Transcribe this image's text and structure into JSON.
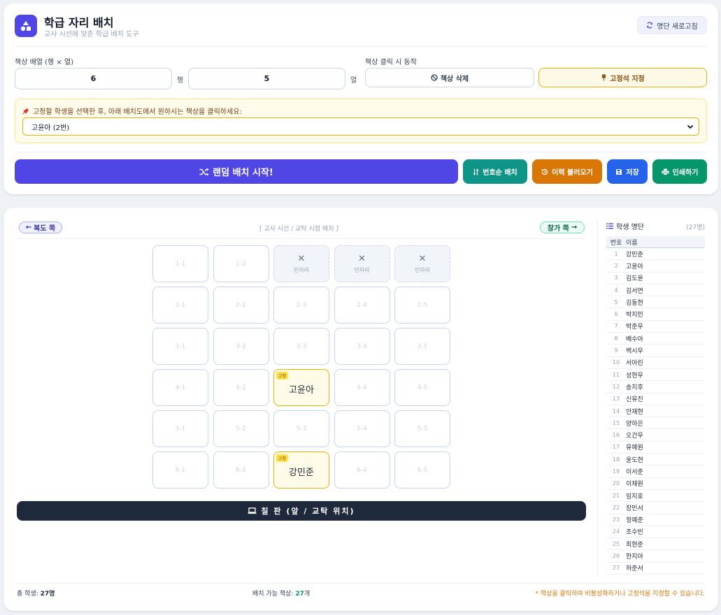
{
  "header": {
    "title": "학급 자리 배치",
    "subtitle": "교사 시선에 맞춘 학급 배치 도구",
    "refresh_label": "명단 새로고침"
  },
  "controls": {
    "layout_label": "책상 배열 (행 × 열)",
    "rows_value": "6",
    "rows_unit": "행",
    "cols_value": "5",
    "cols_unit": "열",
    "click_action_label": "책상 클릭 시 동작",
    "delete_mode_label": "책상 삭제",
    "fixed_mode_label": "고정석 지정"
  },
  "notice": {
    "text": "고정할 학생을 선택한 후, 아래 배치도에서 원하시는 책상을 클릭하세요:",
    "selected_student": "고윤아 (2번)"
  },
  "actions": {
    "random_label": "랜덤 배치 시작!",
    "number_order_label": "번호순 배치",
    "history_label": "이력 불러오기",
    "save_label": "저장",
    "print_label": "인쇄하기"
  },
  "seat_map": {
    "north_label": "복도 쪽",
    "view_label": "[ 교사 시선 / 교탁 시점 배치 ]",
    "window_label": "창가 쪽",
    "empty_label": "빈자리",
    "fixed_badge": "고정",
    "board_label": "칠 판 (앞 / 교탁 위치)",
    "rows": [
      [
        {
          "type": "desk",
          "label": "1-1"
        },
        {
          "type": "desk",
          "label": "1-2"
        },
        {
          "type": "empty"
        },
        {
          "type": "empty"
        },
        {
          "type": "empty"
        }
      ],
      [
        {
          "type": "desk",
          "label": "2-1"
        },
        {
          "type": "desk",
          "label": "2-2"
        },
        {
          "type": "desk",
          "label": "2-3"
        },
        {
          "type": "desk",
          "label": "2-4"
        },
        {
          "type": "desk",
          "label": "2-5"
        }
      ],
      [
        {
          "type": "desk",
          "label": "3-1"
        },
        {
          "type": "desk",
          "label": "3-2"
        },
        {
          "type": "desk",
          "label": "3-3"
        },
        {
          "type": "desk",
          "label": "3-4"
        },
        {
          "type": "desk",
          "label": "3-5"
        }
      ],
      [
        {
          "type": "desk",
          "label": "4-1"
        },
        {
          "type": "desk",
          "label": "4-2"
        },
        {
          "type": "fixed",
          "name": "고윤아"
        },
        {
          "type": "desk",
          "label": "4-4"
        },
        {
          "type": "desk",
          "label": "4-5"
        }
      ],
      [
        {
          "type": "desk",
          "label": "5-1"
        },
        {
          "type": "desk",
          "label": "5-2"
        },
        {
          "type": "desk",
          "label": "5-3"
        },
        {
          "type": "desk",
          "label": "5-4"
        },
        {
          "type": "desk",
          "label": "5-5"
        }
      ],
      [
        {
          "type": "desk",
          "label": "6-1"
        },
        {
          "type": "desk",
          "label": "6-2"
        },
        {
          "type": "fixed",
          "name": "강민준"
        },
        {
          "type": "desk",
          "label": "6-4"
        },
        {
          "type": "desk",
          "label": "6-5"
        }
      ]
    ]
  },
  "footer": {
    "total_label": "총 학생:",
    "total_value": "27명",
    "available_label": "배치 가능 책상:",
    "available_num": "27",
    "available_unit": "개",
    "note": "* 책상을 클릭하여 비활성화하거나 고정석을 지정할 수 있습니다."
  },
  "roster": {
    "title": "학생 명단",
    "count": "(27명)",
    "col_number": "번호",
    "col_name": "이름",
    "students": [
      {
        "n": "1",
        "name": "강민준"
      },
      {
        "n": "2",
        "name": "고윤아"
      },
      {
        "n": "3",
        "name": "김도윤"
      },
      {
        "n": "4",
        "name": "김서연"
      },
      {
        "n": "5",
        "name": "김동현"
      },
      {
        "n": "6",
        "name": "박지민"
      },
      {
        "n": "7",
        "name": "박준우"
      },
      {
        "n": "8",
        "name": "배수아"
      },
      {
        "n": "9",
        "name": "백시우"
      },
      {
        "n": "10",
        "name": "서아린"
      },
      {
        "n": "11",
        "name": "성현우"
      },
      {
        "n": "12",
        "name": "송지후"
      },
      {
        "n": "13",
        "name": "신유진"
      },
      {
        "n": "14",
        "name": "안재현"
      },
      {
        "n": "15",
        "name": "양하은"
      },
      {
        "n": "16",
        "name": "오건우"
      },
      {
        "n": "17",
        "name": "유예원"
      },
      {
        "n": "18",
        "name": "윤도현"
      },
      {
        "n": "19",
        "name": "이서준"
      },
      {
        "n": "20",
        "name": "이채원"
      },
      {
        "n": "21",
        "name": "임지호"
      },
      {
        "n": "22",
        "name": "장민서"
      },
      {
        "n": "23",
        "name": "정예준"
      },
      {
        "n": "24",
        "name": "조수빈"
      },
      {
        "n": "25",
        "name": "최현준"
      },
      {
        "n": "26",
        "name": "한지아"
      },
      {
        "n": "27",
        "name": "허준서"
      }
    ]
  }
}
